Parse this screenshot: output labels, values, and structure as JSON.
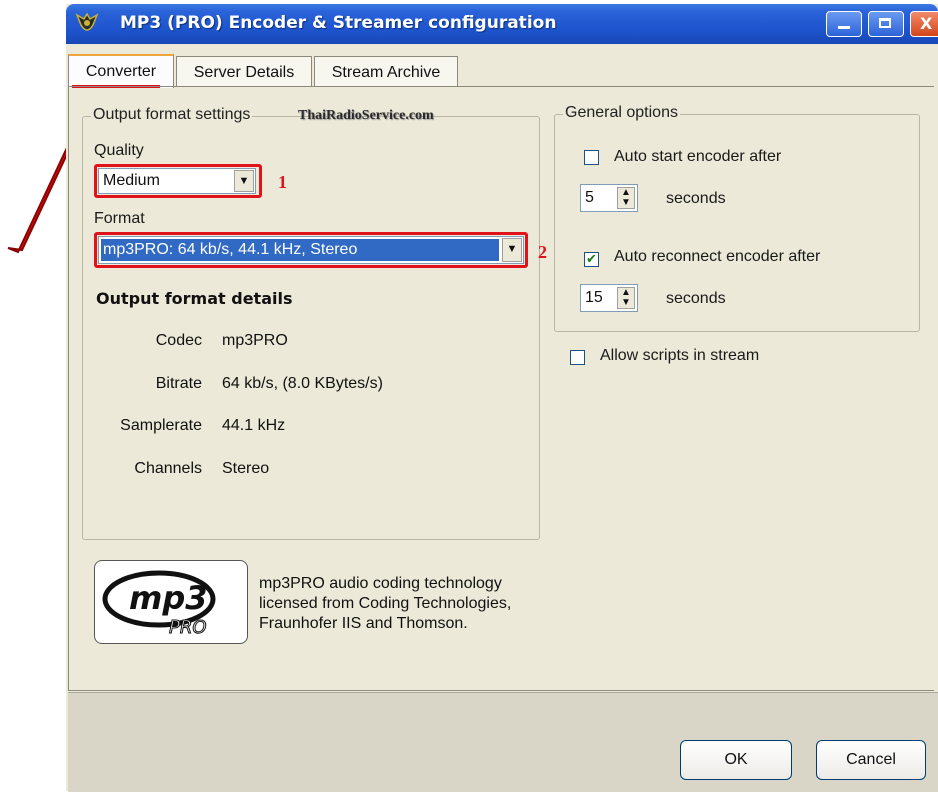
{
  "window": {
    "title": "MP3 (PRO) Encoder & Streamer configuration"
  },
  "tabs": [
    {
      "label": "Converter"
    },
    {
      "label": "Server Details"
    },
    {
      "label": "Stream Archive"
    }
  ],
  "output_settings": {
    "legend": "Output format settings",
    "watermark": "ThaiRadioService.com",
    "quality_label": "Quality",
    "quality_value": "Medium",
    "format_label": "Format",
    "format_value": "mp3PRO: 64 kb/s, 44.1 kHz, Stereo",
    "details_title": "Output format details",
    "details": [
      {
        "key": "Codec",
        "value": "mp3PRO"
      },
      {
        "key": "Bitrate",
        "value": "64 kb/s, (8.0 KBytes/s)"
      },
      {
        "key": "Samplerate",
        "value": "44.1 kHz"
      },
      {
        "key": "Channels",
        "value": "Stereo"
      }
    ]
  },
  "annotations": {
    "marker_1": "1",
    "marker_2": "2",
    "highlight_color": "#e0121a"
  },
  "general_options": {
    "legend": "General options",
    "auto_start": {
      "label": "Auto start encoder after",
      "checked": false,
      "value": "5",
      "unit": "seconds"
    },
    "auto_reconnect": {
      "label": "Auto reconnect encoder after",
      "checked": true,
      "value": "15",
      "unit": "seconds"
    },
    "allow_scripts": {
      "label": "Allow scripts in stream",
      "checked": false
    }
  },
  "about": {
    "logo_text": "mp3 PRO",
    "lines": [
      "mp3PRO audio coding technology",
      "licensed from Coding Technologies,",
      "Fraunhofer IIS and Thomson."
    ]
  },
  "buttons": {
    "ok": "OK",
    "cancel": "Cancel"
  }
}
